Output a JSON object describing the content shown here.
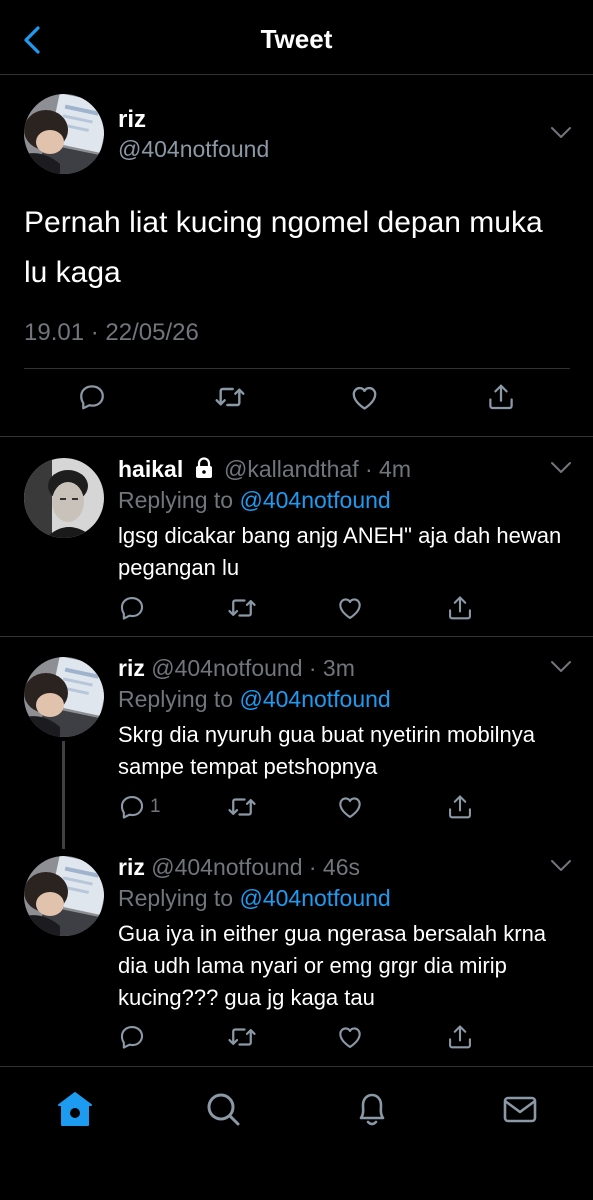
{
  "header": {
    "title": "Tweet"
  },
  "main_tweet": {
    "name": "riz",
    "handle": "@404notfound",
    "text": "Pernah liat kucing ngomel depan muka lu kaga",
    "timestamp": "19.01 · 22/05/26"
  },
  "replies": [
    {
      "name": "haikal",
      "handle_time": "@kallandthaf · 4m",
      "replying_prefix": "Replying to ",
      "replying_to": "@404notfound",
      "text": "lgsg dicakar bang anjg ANEH\" aja dah hewan pegangan lu",
      "reply_count": ""
    },
    {
      "name": "riz",
      "handle_time": "@404notfound · 3m",
      "replying_prefix": "Replying to ",
      "replying_to": "@404notfound",
      "text": "Skrg dia nyuruh gua buat nyetirin mobilnya sampe tempat petshopnya",
      "reply_count": "1"
    },
    {
      "name": "riz",
      "handle_time": "@404notfound · 46s",
      "replying_prefix": "Replying to ",
      "replying_to": "@404notfound",
      "text": "Gua iya in either gua ngerasa bersalah krna dia udh lama nyari or emg grgr dia mirip kucing??? gua jg kaga tau",
      "reply_count": ""
    }
  ],
  "icons": {
    "back": "chevron-left-icon",
    "more": "chevron-down-icon",
    "reply": "comment-icon",
    "retweet": "retweet-icon",
    "like": "heart-icon",
    "share": "share-icon",
    "lock": "lock-icon",
    "tabs": [
      "home-icon",
      "search-icon",
      "bell-icon",
      "mail-icon"
    ]
  },
  "colors": {
    "background": "#000000",
    "accent": "#1d9bf0",
    "secondary_text": "#71767b",
    "divider": "#2f3336"
  }
}
